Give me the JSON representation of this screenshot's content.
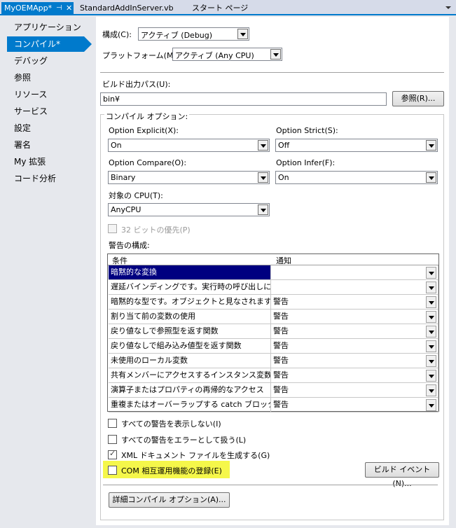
{
  "tabs": [
    {
      "label": "MyOEMApp*",
      "active": true
    },
    {
      "label": "StandardAddInServer.vb"
    },
    {
      "label": "スタート ページ"
    }
  ],
  "sidebar": {
    "items": [
      {
        "label": "アプリケーション"
      },
      {
        "label": "コンパイル*",
        "selected": true
      },
      {
        "label": "デバッグ"
      },
      {
        "label": "参照"
      },
      {
        "label": "リソース"
      },
      {
        "label": "サービス"
      },
      {
        "label": "設定"
      },
      {
        "label": "署名"
      },
      {
        "label": "My 拡張"
      },
      {
        "label": "コード分析"
      }
    ]
  },
  "config": {
    "config_label": "構成(C):",
    "config_value": "アクティブ (Debug)",
    "platform_label": "プラットフォーム(M):",
    "platform_value": "アクティブ (Any CPU)"
  },
  "build_output": {
    "label": "ビルド出力パス(U):",
    "value": "bin¥",
    "browse_button": "参照(R)..."
  },
  "compile_options": {
    "group_label": "コンパイル オプション:",
    "option_explicit_label": "Option Explicit(X):",
    "option_explicit_value": "On",
    "option_strict_label": "Option Strict(S):",
    "option_strict_value": "Off",
    "option_compare_label": "Option Compare(O):",
    "option_compare_value": "Binary",
    "option_infer_label": "Option Infer(F):",
    "option_infer_value": "On",
    "target_cpu_label": "対象の CPU(T):",
    "target_cpu_value": "AnyCPU",
    "prefer32_label": "32 ビットの優先(P)"
  },
  "warnings": {
    "label": "警告の構成:",
    "col_condition": "条件",
    "col_notify": "通知",
    "rows": [
      {
        "condition": "暗黙的な変換",
        "notify": ""
      },
      {
        "condition": "遅延バインディングです。実行時の呼び出しに…",
        "notify": ""
      },
      {
        "condition": "暗黙的な型です。オブジェクトと見なされます。",
        "notify": "警告"
      },
      {
        "condition": "割り当て前の変数の使用",
        "notify": "警告"
      },
      {
        "condition": "戻り値なしで参照型を返す関数",
        "notify": "警告"
      },
      {
        "condition": "戻り値なしで組み込み値型を返す関数",
        "notify": "警告"
      },
      {
        "condition": "未使用のローカル変数",
        "notify": "警告"
      },
      {
        "condition": "共有メンバーにアクセスするインスタンス変数",
        "notify": "警告"
      },
      {
        "condition": "演算子またはプロパティの再帰的なアクセス",
        "notify": "警告"
      },
      {
        "condition": "重複またはオーバーラップする catch ブロック",
        "notify": "警告"
      }
    ]
  },
  "checks": {
    "disable_all_warnings": "すべての警告を表示しない(I)",
    "warnings_as_errors": "すべての警告をエラーとして扱う(L)",
    "generate_xml": "XML ドキュメント ファイルを生成する(G)",
    "register_com": "COM 相互運用機能の登録(E)"
  },
  "buttons": {
    "build_events": "ビルド イベント(N)...",
    "advanced_compile": "詳細コンパイル オプション(A)..."
  },
  "colors": {
    "accent": "#007acc",
    "highlight": "#f5f74a",
    "selected_row": "#000080"
  }
}
